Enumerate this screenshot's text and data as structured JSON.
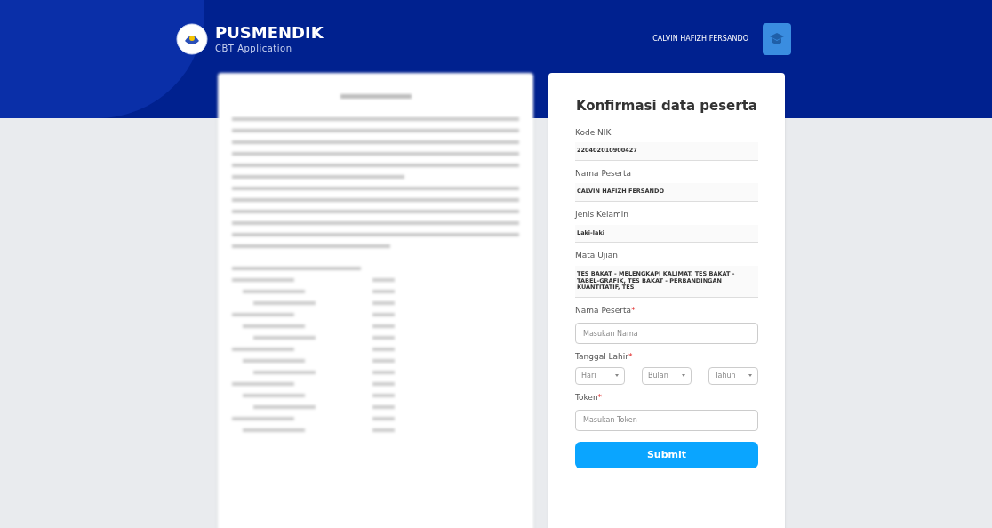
{
  "header": {
    "brand": "PUSMENDIK",
    "subtitle": "CBT Application",
    "user": "CALVIN HAFIZH FERSANDO"
  },
  "form": {
    "title": "Konfirmasi data peserta",
    "info": [
      {
        "label": "Kode NIK",
        "value": "220402010900427"
      },
      {
        "label": "Nama Peserta",
        "value": "CALVIN HAFIZH FERSANDO"
      },
      {
        "label": "Jenis Kelamin",
        "value": "Laki-laki"
      },
      {
        "label": "Mata Ujian",
        "value": "TES BAKAT - MELENGKAPI KALIMAT, TES BAKAT - TABEL-GRAFIK, TES BAKAT - PERBANDINGAN KUANTITATIF, TES"
      }
    ],
    "name_field": {
      "label": "Nama Peserta",
      "required_mark": "*",
      "placeholder": "Masukan Nama"
    },
    "birth": {
      "label": "Tanggal Lahir",
      "required_mark": "*",
      "selects": [
        "Hari",
        "Bulan",
        "Tahun"
      ]
    },
    "token_field": {
      "label": "Token",
      "required_mark": "*",
      "placeholder": "Masukan Token"
    },
    "submit": "Submit"
  }
}
